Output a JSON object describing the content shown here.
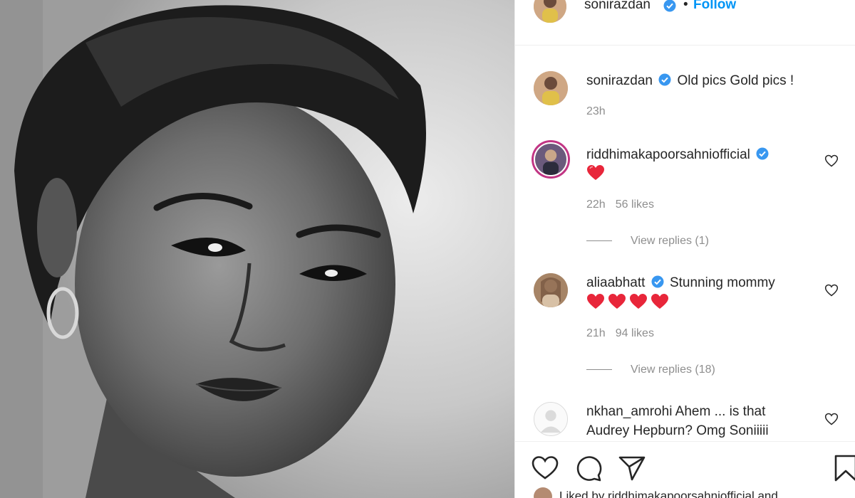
{
  "post": {
    "author": "sonirazdan",
    "follow_label": "Follow",
    "dot": "•"
  },
  "caption": {
    "username": "sonirazdan",
    "text": "Old pics Gold pics !",
    "time": "23h"
  },
  "comments": [
    {
      "username": "riddhimakapoorsahniofficial",
      "text": "",
      "emoji": [
        "red-heart-icon"
      ],
      "time": "22h",
      "likes": "56 likes",
      "replies": "View replies (1)",
      "verified": true
    },
    {
      "username": "aliaabhatt",
      "text": "Stunning mommy",
      "emoji": [
        "red-heart-icon",
        "red-heart-icon",
        "red-heart-icon",
        "red-heart-icon"
      ],
      "time": "21h",
      "likes": "94 likes",
      "replies": "View replies (18)",
      "verified": true
    },
    {
      "username": "nkhan_amrohi",
      "text_line1": "Ahem ... is that",
      "text_line2": "Audrey Hepburn? Omg Soniiiii",
      "verified": false
    }
  ],
  "actions": {
    "icons": [
      "heart-icon",
      "comment-icon",
      "share-icon",
      "bookmark-icon"
    ]
  },
  "liked_by": "Liked by riddhimakapoorsahniofficial and",
  "colors": {
    "link": "#0095f6",
    "verified": "#3897f0",
    "muted": "#8e8e8e",
    "heart": "#e8263a"
  }
}
